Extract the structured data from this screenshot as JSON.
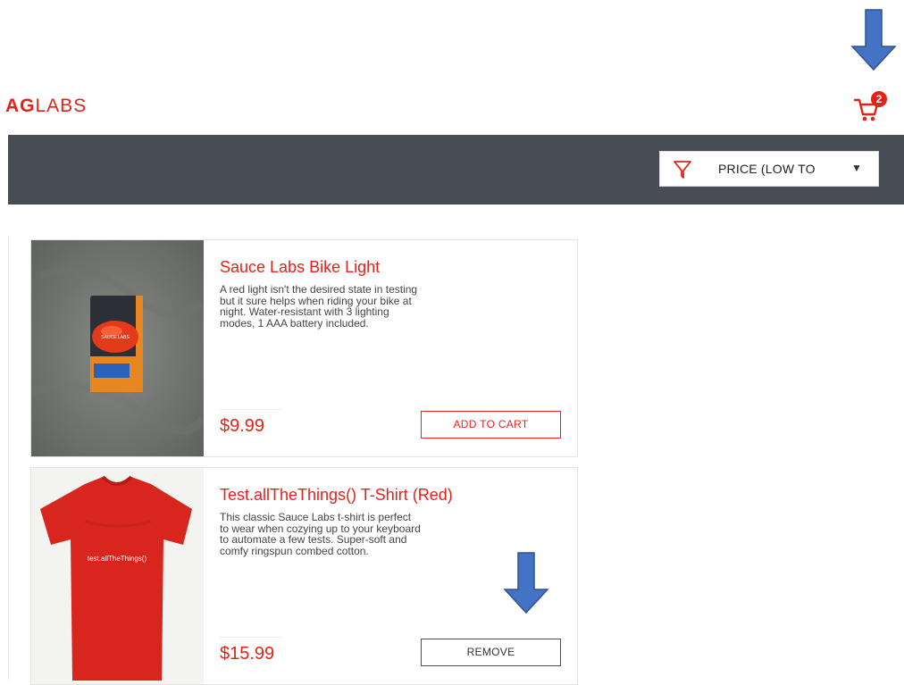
{
  "header": {
    "logo_bold": "AG",
    "logo_light": "LABS",
    "cart_count": "2"
  },
  "sort": {
    "selected": "PRICE (LOW TO"
  },
  "items": [
    {
      "name": "Sauce Labs Bike Light",
      "description": "A red light isn't the desired state in testing but it sure helps when riding your bike at night. Water-resistant with 3 lighting modes, 1 AAA battery included.",
      "price": "$9.99",
      "button_label": "ADD TO CART",
      "image_text": "SAUCE LABS"
    },
    {
      "name": "Test.allTheThings() T-Shirt (Red)",
      "description": "This classic Sauce Labs t-shirt is perfect to wear when cozying up to your keyboard to automate a few tests. Super-soft and comfy ringspun combed cotton.",
      "price": "$15.99",
      "button_label": "REMOVE",
      "image_text": "test.allTheThings()"
    }
  ],
  "colors": {
    "accent": "#e2231a",
    "header_bar": "#474c55",
    "annotation_arrow": "#4472c4"
  },
  "icons": {
    "cart": "shopping-cart-icon",
    "sort": "filter-funnel-icon",
    "caret": "caret-down-icon",
    "annotation": "arrow-down-icon"
  }
}
